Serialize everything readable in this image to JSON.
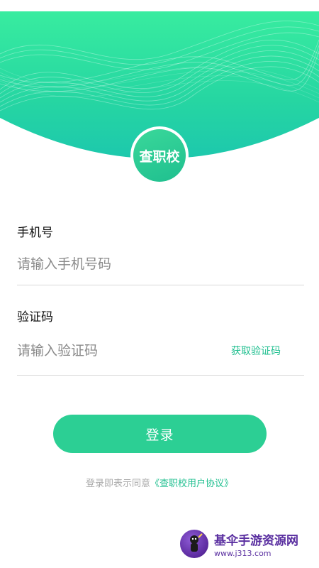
{
  "app": {
    "logo_text": "查职校"
  },
  "form": {
    "phone": {
      "label": "手机号",
      "placeholder": "请输入手机号码",
      "value": ""
    },
    "code": {
      "label": "验证码",
      "placeholder": "请输入验证码",
      "value": "",
      "get_code_label": "获取验证码"
    },
    "login_label": "登录"
  },
  "agreement": {
    "prefix": "登录即表示同意",
    "link": "《查职校用户协议》"
  },
  "watermark": {
    "title": "基伞手游资源网",
    "url": "www.j313.com"
  },
  "colors": {
    "accent": "#2ccf94",
    "accent_dark": "#1fbf8f",
    "header_top": "#2ee6a0",
    "header_bottom": "#1ec9a8"
  }
}
